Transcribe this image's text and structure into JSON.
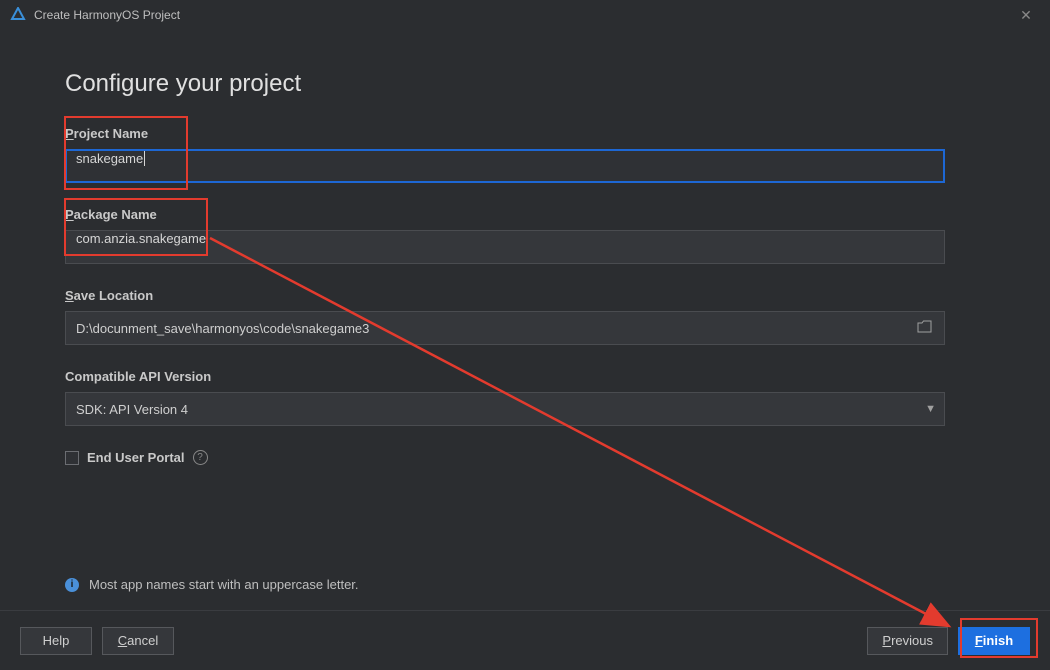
{
  "window": {
    "title": "Create HarmonyOS Project"
  },
  "page": {
    "heading": "Configure your project"
  },
  "fields": {
    "project_name": {
      "label_prefix": "P",
      "label_rest": "roject Name",
      "value": "snakegame"
    },
    "package_name": {
      "label_prefix": "P",
      "label_rest": "ackage Name",
      "value": "com.anzia.snakegame"
    },
    "save_location": {
      "label_prefix": "S",
      "label_rest": "ave Location",
      "value": "D:\\docunment_save\\harmonyos\\code\\snakegame3"
    },
    "api_version": {
      "label": "Compatible API Version",
      "value": "SDK: API Version 4"
    },
    "end_user_portal": {
      "label": "End User Portal",
      "checked": false
    }
  },
  "info": {
    "message": "Most app names start with an uppercase letter."
  },
  "buttons": {
    "help": "Help",
    "cancel_prefix": "C",
    "cancel_rest": "ancel",
    "previous_prefix": "P",
    "previous_rest": "revious",
    "finish_prefix": "F",
    "finish_rest": "inish"
  }
}
